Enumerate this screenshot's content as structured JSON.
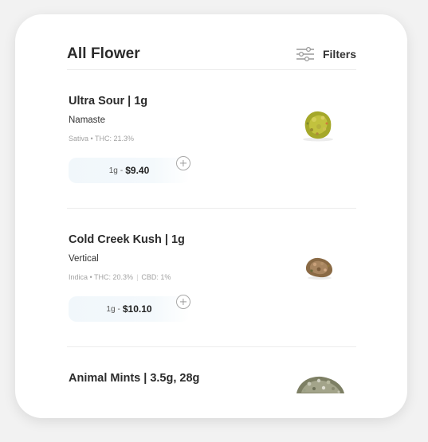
{
  "header": {
    "title": "All Flower",
    "filters_label": "Filters"
  },
  "products": [
    {
      "name": "Ultra Sour | 1g",
      "brand": "Namaste",
      "strain": "Sativa",
      "thc": "THC: 21.3%",
      "price_weight": "1g",
      "price_amount": "$9.40"
    },
    {
      "name": "Cold Creek Kush | 1g",
      "brand": "Vertical",
      "strain": "Indica",
      "thc": "THC: 20.3%",
      "cbd": "CBD: 1%",
      "price_weight": "1g",
      "price_amount": "$10.10"
    },
    {
      "name": "Animal Mints | 3.5g, 28g"
    }
  ],
  "colors": {
    "background": "#f2f2f2",
    "card": "#ffffff",
    "price_pill": "#f1f7fb",
    "divider": "#ececec",
    "meta_text": "#a3a3a3"
  },
  "icons": [
    "sliders-icon",
    "plus-circle-icon",
    "product-image"
  ]
}
